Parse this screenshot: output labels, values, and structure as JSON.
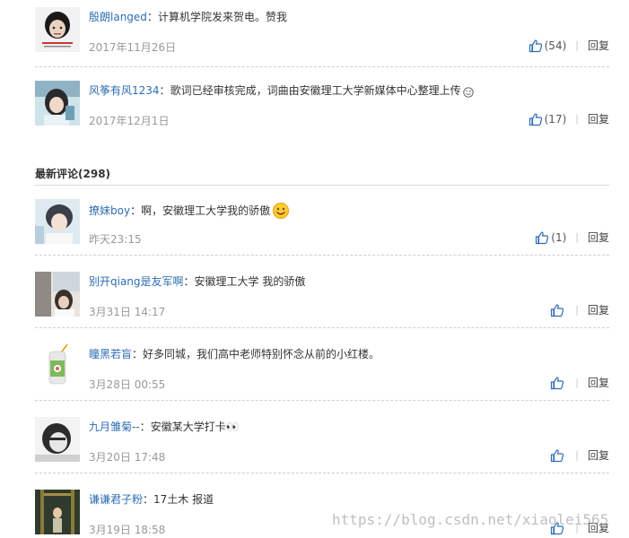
{
  "top_comments": [
    {
      "username": "殷朗langed",
      "text": "计算机学院发来贺电。赞我",
      "date": "2017年11月26日",
      "likes": "(54)",
      "reply": "回复"
    },
    {
      "username": "风筝有风1234",
      "text": "歌词已经审核完成，词曲由安徽理工大学新媒体中心整理上传",
      "emoji": "wink-emoji",
      "date": "2017年12月1日",
      "likes": "(17)",
      "reply": "回复"
    }
  ],
  "latest_header": {
    "title": "最新评论",
    "count": "(298)"
  },
  "latest_comments": [
    {
      "username": "撩妹boy",
      "text": "啊，安徽理工大学我的骄傲",
      "emoji": "smile-emoji",
      "date": "昨天23:15",
      "likes": "(1)",
      "reply": "回复"
    },
    {
      "username": "别开qiang是友军啊",
      "text": "安徽理工大学 我的骄傲",
      "date": "3月31日 14:17",
      "likes": "",
      "reply": "回复"
    },
    {
      "username": "瞳黑若盲",
      "text": "好多同城，我们高中老师特别怀念从前的小红楼。",
      "date": "3月28日 00:55",
      "likes": "",
      "reply": "回复"
    },
    {
      "username": "九月雏菊--",
      "text": "安徽某大学打卡👀",
      "date": "3月20日 17:48",
      "likes": "",
      "reply": "回复"
    },
    {
      "username": "谦谦君子粉",
      "text": "17土木 报道",
      "date": "3月19日 18:58",
      "likes": "",
      "reply": "回复"
    }
  ],
  "watermark": "https://blog.csdn.net/xiaolei565",
  "colors": {
    "username": "#2e6db3",
    "date": "#999999",
    "thumb": "#2e6db3"
  }
}
